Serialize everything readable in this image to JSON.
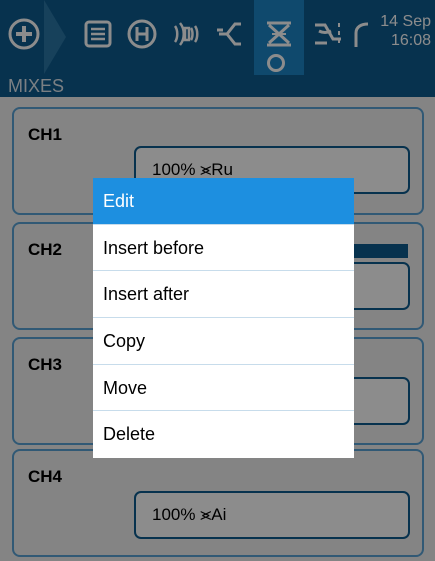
{
  "topbar": {
    "icons": [
      "plus-circle-icon",
      "list-icon",
      "heli-icon",
      "sound-icon",
      "mix-icon",
      "crossed-mixes-icon",
      "curve-icon",
      "curve-arc-icon"
    ],
    "date": "14 Sep",
    "time": "16:08",
    "active_color": "#1d86c7",
    "bar_color": "#0e5c8f"
  },
  "section": {
    "title": "MIXES"
  },
  "channels": [
    {
      "label": "CH1",
      "mix": "100% ⪤Ru"
    },
    {
      "label": "CH2",
      "mix": ""
    },
    {
      "label": "CH3",
      "mix": ""
    },
    {
      "label": "CH4",
      "mix": "100% ⪤Ai"
    }
  ],
  "menu": {
    "items": [
      "Edit",
      "Insert before",
      "Insert after",
      "Copy",
      "Move",
      "Delete"
    ],
    "selected": "Edit",
    "selected_color": "#1d8fe0"
  }
}
